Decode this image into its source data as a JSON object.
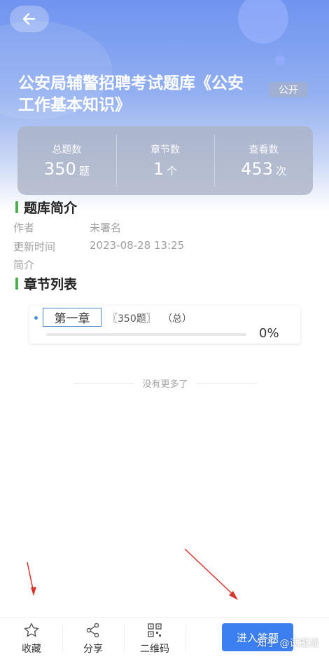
{
  "header": {
    "title": "公安局辅警招聘考试题库《公安工作基本知识》",
    "badge": "公开"
  },
  "stats": [
    {
      "label": "总题数",
      "value": "350",
      "unit": "题"
    },
    {
      "label": "章节数",
      "value": "1",
      "unit": "个"
    },
    {
      "label": "查看数",
      "value": "453",
      "unit": "次"
    }
  ],
  "intro": {
    "heading": "题库简介",
    "author_label": "作者",
    "author_value": "未署名",
    "updated_label": "更新时间",
    "updated_value": "2023-08-28 13:25",
    "desc_label": "简介"
  },
  "chapters": {
    "heading": "章节列表",
    "items": [
      {
        "name": "第一章",
        "count": "〖350题〗",
        "total": "（总）",
        "progress": "0%",
        "progress_value": 0
      }
    ]
  },
  "no_more": "没有更多了",
  "tabbar": {
    "favorite": "收藏",
    "share": "分享",
    "qrcode": "二维码",
    "enter": "进入答题"
  },
  "watermark": "知乎 @试题通",
  "colors": {
    "primary": "#3b7ff0",
    "section_bar": "#4caf50",
    "arrow": "#d9342b"
  }
}
